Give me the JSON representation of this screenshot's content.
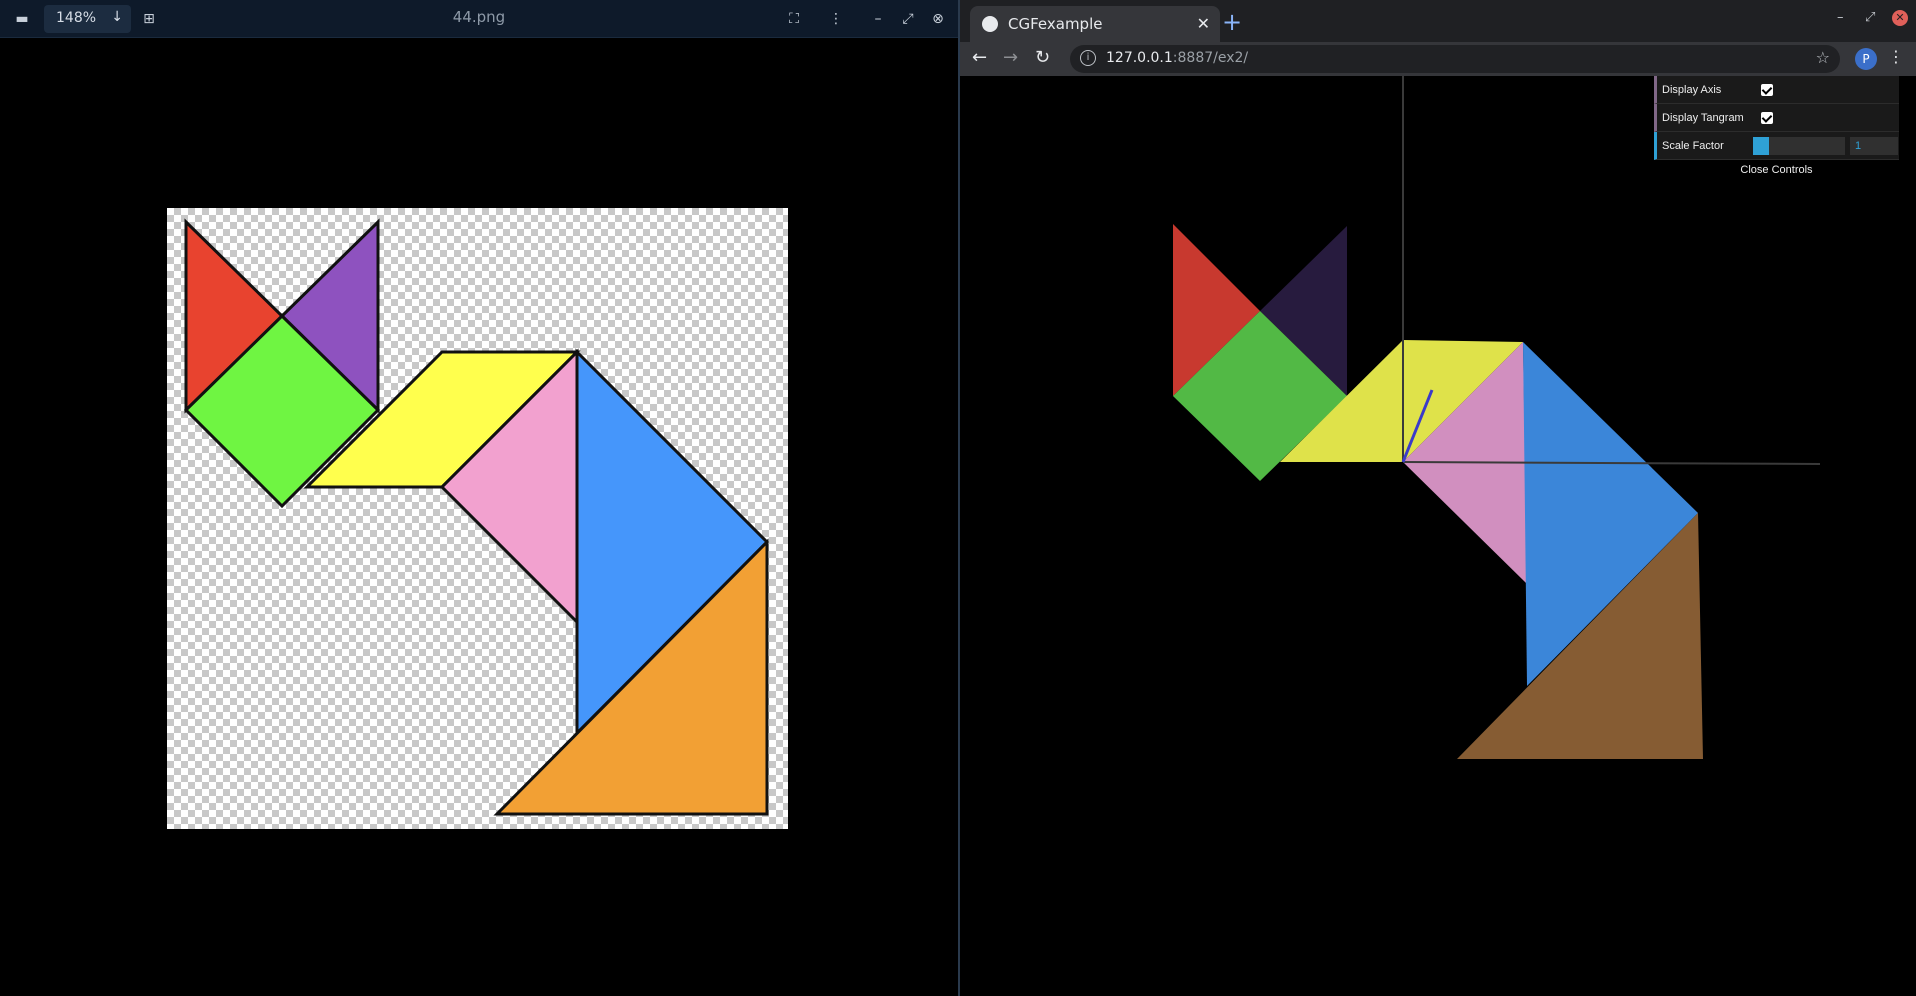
{
  "viewer": {
    "zoom": "148%",
    "file_name": "44.png",
    "icons": [
      "zoom-out-icon",
      "chevron-down-icon",
      "zoom-in-icon",
      "fullscreen-icon",
      "kebab-icon",
      "minimize-icon",
      "restore-icon",
      "close-icon"
    ]
  },
  "tangram_colors": {
    "red": "#e8432f",
    "purple": "#8e52bf",
    "green": "#6ff542",
    "yellow": "#ffff4d",
    "pink": "#f2a1cf",
    "blue": "#4596fb",
    "orange": "#f2a034",
    "outline": "#111111"
  },
  "browser": {
    "tab_title": "CGFexample",
    "url_host": "127.0.0.1",
    "url_rest": ":8887/ex2/",
    "avatar_initial": "P",
    "icons": [
      "back-icon",
      "forward-icon",
      "reload-icon",
      "info-icon",
      "star-icon",
      "new-tab-icon"
    ]
  },
  "scene_colors": {
    "red": "#c8392f",
    "purple": "#271b3e",
    "green": "#52b945",
    "yellow": "#dfe24a",
    "pink": "#d18fbf",
    "blue": "#3b86d9",
    "brown": "#865c33",
    "axis": "#3a3a3a",
    "axis_z": "#3b3bc9"
  },
  "gui": {
    "display_axis_label": "Display Axis",
    "display_axis_checked": true,
    "display_tangram_label": "Display Tangram",
    "display_tangram_checked": true,
    "scale_factor_label": "Scale Factor",
    "scale_factor_value": "1",
    "close_label": "Close Controls"
  }
}
